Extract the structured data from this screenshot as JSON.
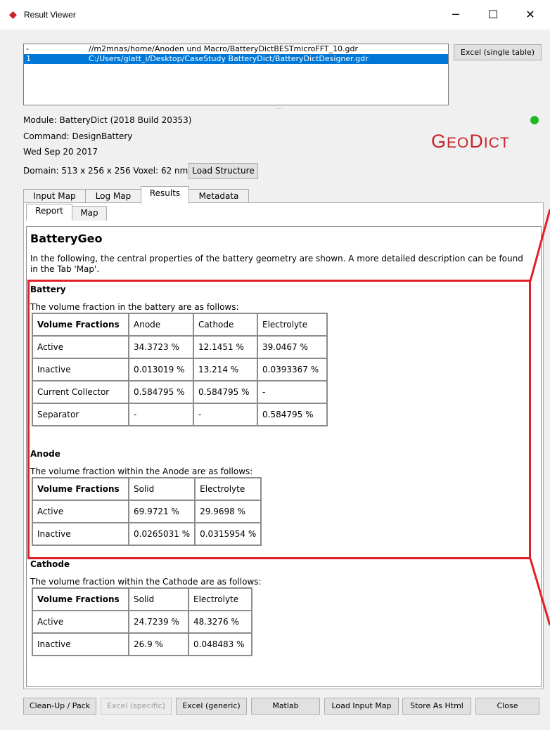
{
  "window": {
    "title": "Result Viewer",
    "minimize_glyph": "─",
    "maximize_glyph": "☐",
    "close_glyph": "✕"
  },
  "files": [
    {
      "index": "-",
      "path": "//m2mnas/home/Anoden und  Macro/BatteryDictBESTmicroFFT_10.gdr"
    },
    {
      "index": "1",
      "path": "C:/Users/glatt_i/Desktop/CaseStudy BatteryDict/BatteryDictDesigner.gdr"
    }
  ],
  "splitter_dots": ".....",
  "excel_single_label": "Excel (single table)",
  "info": {
    "module": "Module:  BatteryDict   (2018 Build 20353)",
    "command": "Command:  DesignBattery",
    "date": "Wed Sep 20 2017",
    "domain": "Domain: 513 x 256 x 256    Voxel: 62 nm"
  },
  "load_structure_label": "Load Structure",
  "status_color": "#21b721",
  "logo": {
    "g": "G",
    "eo": "EO",
    "d": "D",
    "ict": "ICT",
    "color": "#c8232c"
  },
  "tabs": [
    "Input Map",
    "Log Map",
    "Results",
    "Metadata"
  ],
  "subtabs": [
    "Report",
    "Map"
  ],
  "report": {
    "title": "BatteryGeo",
    "intro": "In the following, the central properties of the battery geometry are shown. A more detailed description can be found in the Tab 'Map'.",
    "battery": {
      "heading": "Battery",
      "desc": "The volume fraction in the battery are as follows:",
      "header": [
        "Volume Fractions",
        "Anode",
        "Cathode",
        "Electrolyte"
      ],
      "rows": [
        [
          "Active",
          "34.3723 %",
          "12.1451 %",
          "39.0467 %"
        ],
        [
          "Inactive",
          "0.013019 %",
          "13.214 %",
          "0.0393367 %"
        ],
        [
          "Current Collector",
          "0.584795 %",
          "0.584795 %",
          "-"
        ],
        [
          "Separator",
          "-",
          "-",
          "0.584795 %"
        ]
      ]
    },
    "anode": {
      "heading": "Anode",
      "desc": "The volume fraction within the Anode are as follows:",
      "header": [
        "Volume Fractions",
        "Solid",
        "Electrolyte"
      ],
      "rows": [
        [
          "Active",
          "69.9721 %",
          "29.9698 %"
        ],
        [
          "Inactive",
          "0.0265031 %",
          "0.0315954 %"
        ]
      ]
    },
    "cathode": {
      "heading": "Cathode",
      "desc": "The volume fraction within the Cathode are as follows:",
      "header": [
        "Volume Fractions",
        "Solid",
        "Electrolyte"
      ],
      "rows": [
        [
          "Active",
          "24.7239 %",
          "48.3276 %"
        ],
        [
          "Inactive",
          "26.9 %",
          "0.048483 %"
        ]
      ]
    }
  },
  "annotation_color": "#e11f27",
  "bottom_buttons": [
    {
      "label": "Clean-Up / Pack",
      "disabled": false
    },
    {
      "label": "Excel (specific)",
      "disabled": true
    },
    {
      "label": "Excel (generic)",
      "disabled": false
    },
    {
      "label": "Matlab",
      "disabled": false
    },
    {
      "label": "Load Input Map",
      "disabled": false
    },
    {
      "label": "Store As Html",
      "disabled": false
    },
    {
      "label": "Close",
      "disabled": false
    }
  ]
}
